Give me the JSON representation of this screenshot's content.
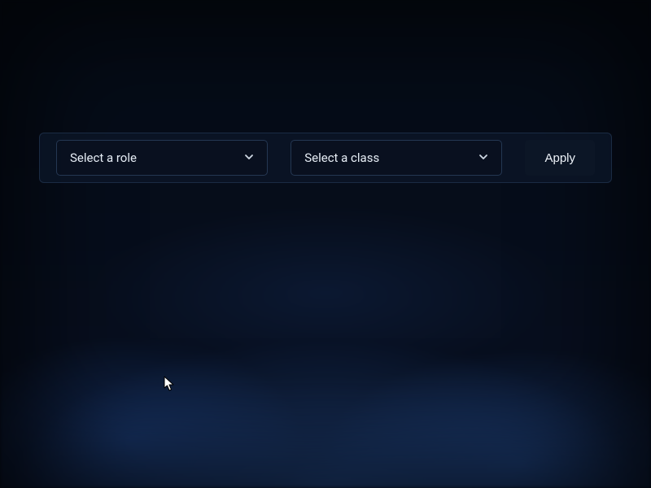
{
  "filters": {
    "role_select": {
      "placeholder": "Select a role",
      "selected": null
    },
    "class_select": {
      "placeholder": "Select a class",
      "selected": null
    },
    "apply_label": "Apply"
  }
}
